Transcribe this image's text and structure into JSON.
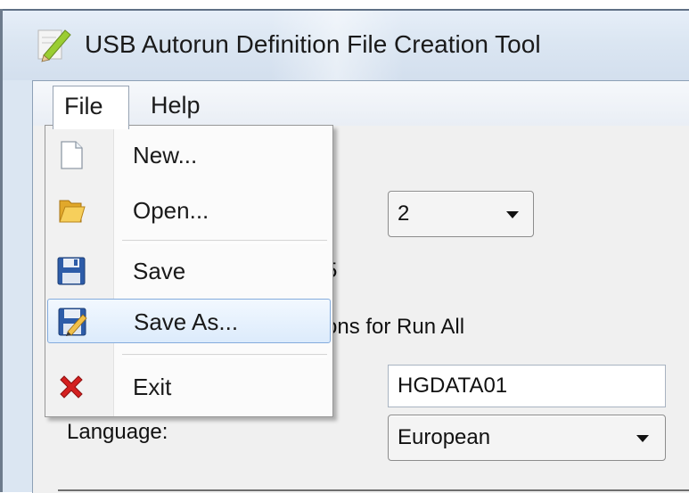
{
  "window": {
    "title": "USB Autorun Definition File Creation Tool"
  },
  "menubar": {
    "file": "File",
    "help": "Help"
  },
  "file_menu": {
    "items": [
      {
        "label": "New...",
        "icon": "new-document-icon"
      },
      {
        "label": "Open...",
        "icon": "open-folder-icon"
      },
      {
        "label": "Save",
        "icon": "floppy-save-icon"
      },
      {
        "label": "Save As...",
        "icon": "save-as-icon",
        "highlighted": true
      },
      {
        "label": "Exit",
        "icon": "exit-x-icon"
      }
    ]
  },
  "form": {
    "count_combo_value": "2",
    "partial_text_1": "5",
    "partial_text_2": "ons for Run All",
    "volume_value": "HGDATA01",
    "language_label": "Language:",
    "language_value": "European"
  },
  "colors": {
    "highlight_border": "#84acdd",
    "highlight_fill": "#dcebfc",
    "exit_red": "#d42020"
  }
}
